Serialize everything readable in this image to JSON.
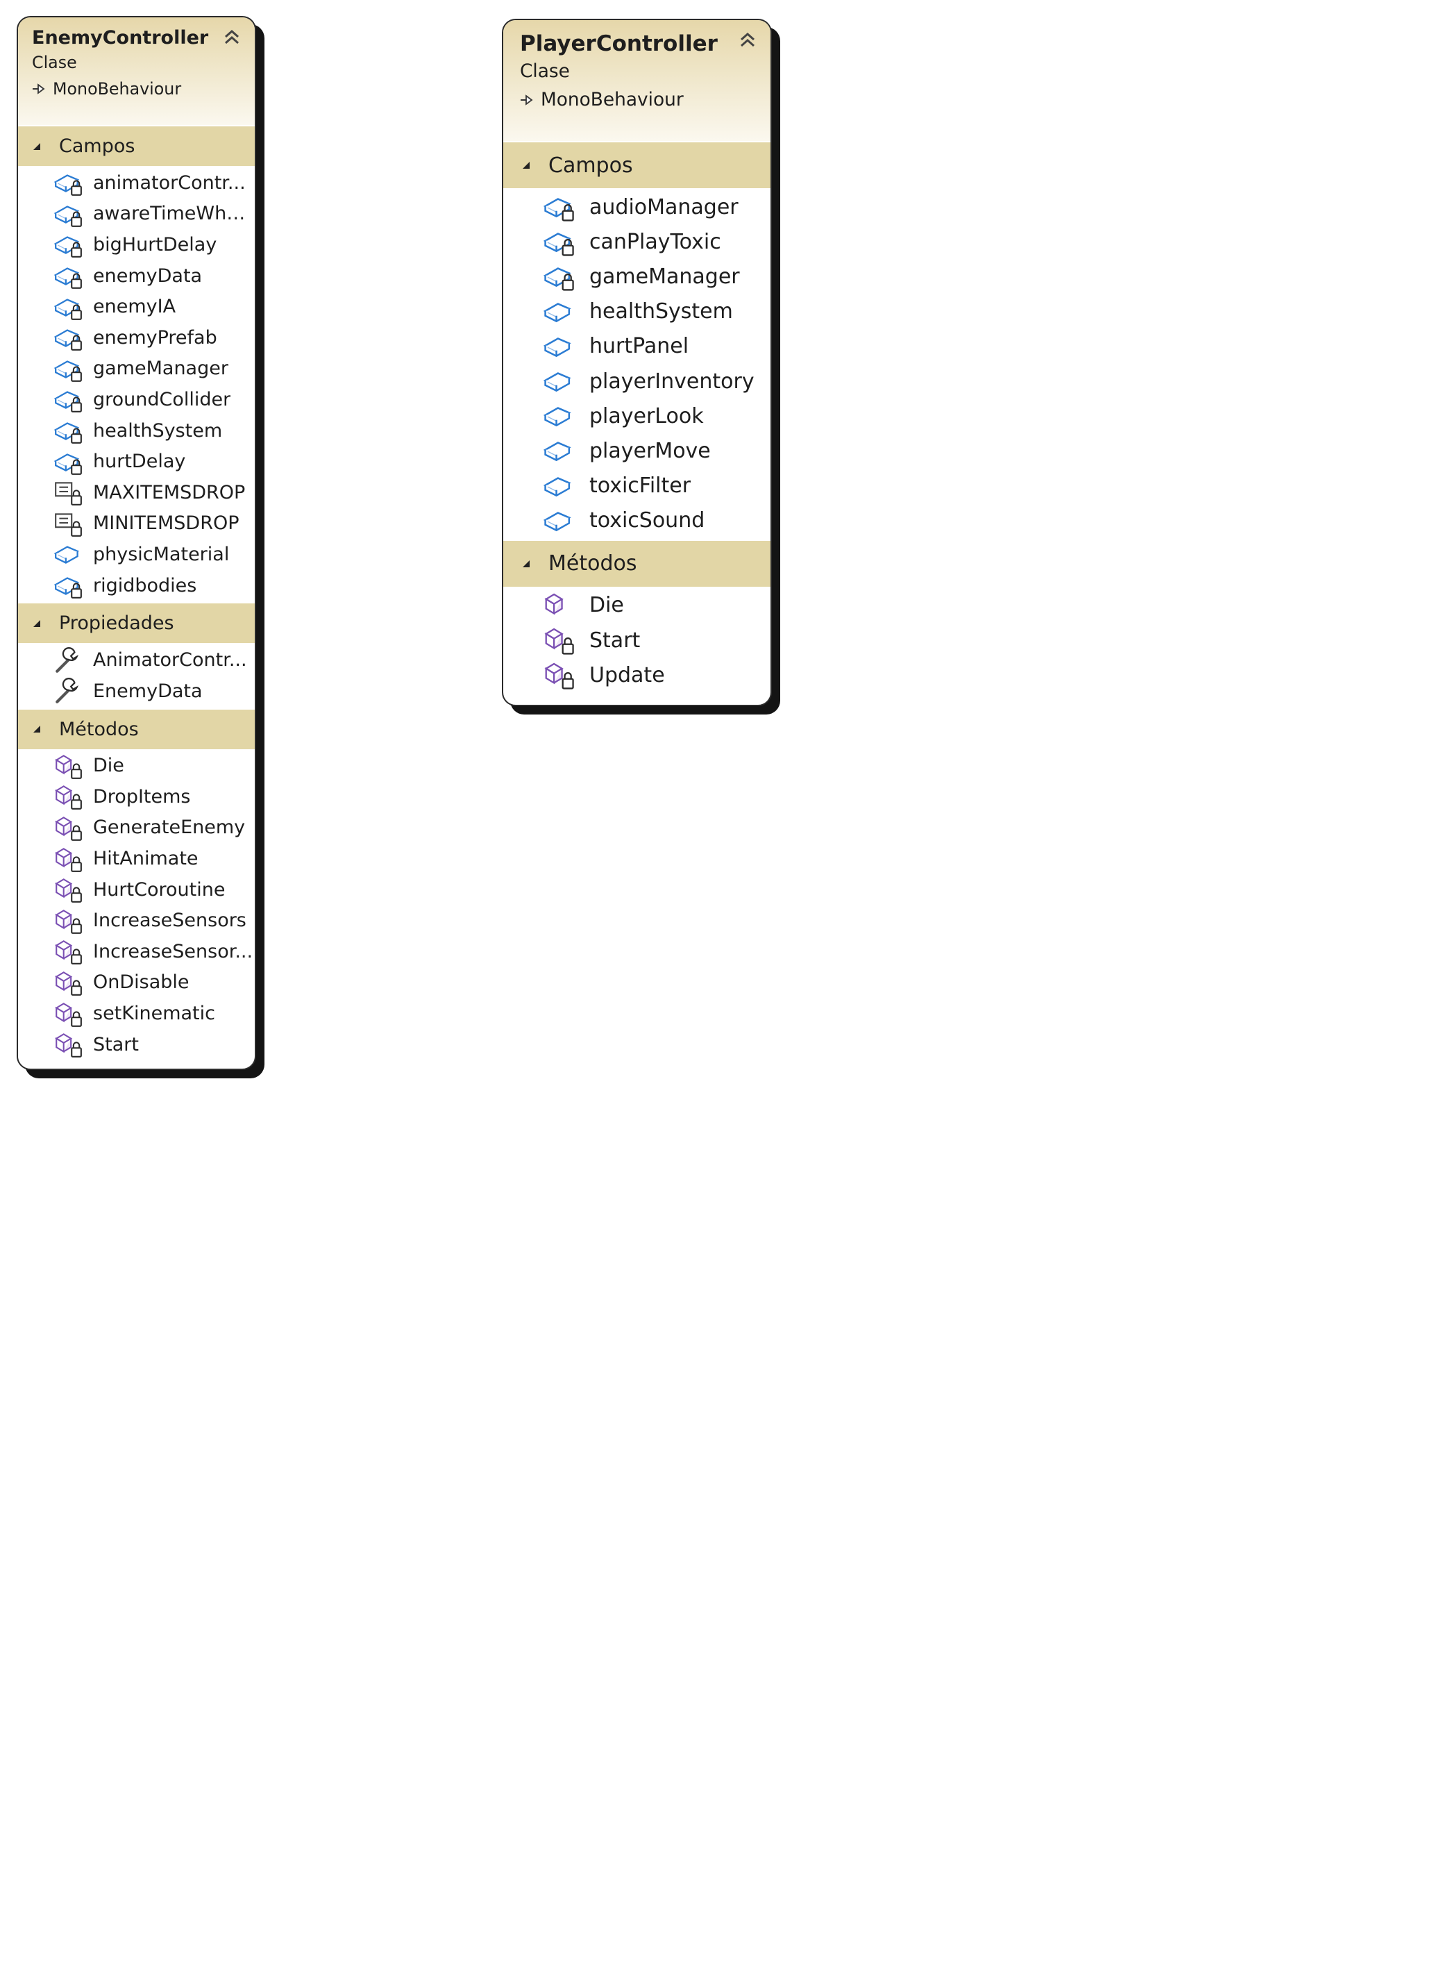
{
  "diagrams": {
    "enemy": {
      "name": "EnemyController",
      "stereotype": "Clase",
      "base": "MonoBehaviour",
      "sections": [
        {
          "title": "Campos",
          "items": [
            {
              "label": "animatorContr...",
              "icon": "private-field-icon"
            },
            {
              "label": "awareTimeWhe...",
              "icon": "private-field-icon"
            },
            {
              "label": "bigHurtDelay",
              "icon": "private-field-icon"
            },
            {
              "label": "enemyData",
              "icon": "private-field-icon"
            },
            {
              "label": "enemyIA",
              "icon": "private-field-icon"
            },
            {
              "label": "enemyPrefab",
              "icon": "private-field-icon"
            },
            {
              "label": "gameManager",
              "icon": "private-field-icon"
            },
            {
              "label": "groundCollider",
              "icon": "private-field-icon"
            },
            {
              "label": "healthSystem",
              "icon": "private-field-icon"
            },
            {
              "label": "hurtDelay",
              "icon": "private-field-icon"
            },
            {
              "label": "MAXITEMSDROP",
              "icon": "private-constant-icon"
            },
            {
              "label": "MINITEMSDROP",
              "icon": "private-constant-icon"
            },
            {
              "label": "physicMaterial",
              "icon": "public-field-icon"
            },
            {
              "label": "rigidbodies",
              "icon": "private-field-icon"
            }
          ]
        },
        {
          "title": "Propiedades",
          "items": [
            {
              "label": "AnimatorContr...",
              "icon": "property-wrench-icon"
            },
            {
              "label": "EnemyData",
              "icon": "property-wrench-icon"
            }
          ]
        },
        {
          "title": "Métodos",
          "items": [
            {
              "label": "Die",
              "icon": "private-method-icon"
            },
            {
              "label": "DropItems",
              "icon": "private-method-icon"
            },
            {
              "label": "GenerateEnemy",
              "icon": "private-method-icon"
            },
            {
              "label": "HitAnimate",
              "icon": "private-method-icon"
            },
            {
              "label": "HurtCoroutine",
              "icon": "private-method-icon"
            },
            {
              "label": "IncreaseSensors",
              "icon": "private-method-icon"
            },
            {
              "label": "IncreaseSensor...",
              "icon": "private-method-icon"
            },
            {
              "label": "OnDisable",
              "icon": "private-method-icon"
            },
            {
              "label": "setKinematic",
              "icon": "private-method-icon"
            },
            {
              "label": "Start",
              "icon": "private-method-icon"
            }
          ]
        }
      ]
    },
    "player": {
      "name": "PlayerController",
      "stereotype": "Clase",
      "base": "MonoBehaviour",
      "sections": [
        {
          "title": "Campos",
          "items": [
            {
              "label": "audioManager",
              "icon": "private-field-icon"
            },
            {
              "label": "canPlayToxic",
              "icon": "private-field-icon"
            },
            {
              "label": "gameManager",
              "icon": "private-field-icon"
            },
            {
              "label": "healthSystem",
              "icon": "public-field-icon"
            },
            {
              "label": "hurtPanel",
              "icon": "public-field-icon"
            },
            {
              "label": "playerInventory",
              "icon": "public-field-icon"
            },
            {
              "label": "playerLook",
              "icon": "public-field-icon"
            },
            {
              "label": "playerMove",
              "icon": "public-field-icon"
            },
            {
              "label": "toxicFilter",
              "icon": "public-field-icon"
            },
            {
              "label": "toxicSound",
              "icon": "public-field-icon"
            }
          ]
        },
        {
          "title": "Métodos",
          "items": [
            {
              "label": "Die",
              "icon": "public-method-icon"
            },
            {
              "label": "Start",
              "icon": "private-method-icon"
            },
            {
              "label": "Update",
              "icon": "private-method-icon"
            }
          ]
        }
      ]
    }
  },
  "colors": {
    "header_gradient_top": "#e6d7aa",
    "section_band": "#e2d6a6",
    "field_blue": "#2b7cd3",
    "method_purple": "#7a4fb3"
  }
}
